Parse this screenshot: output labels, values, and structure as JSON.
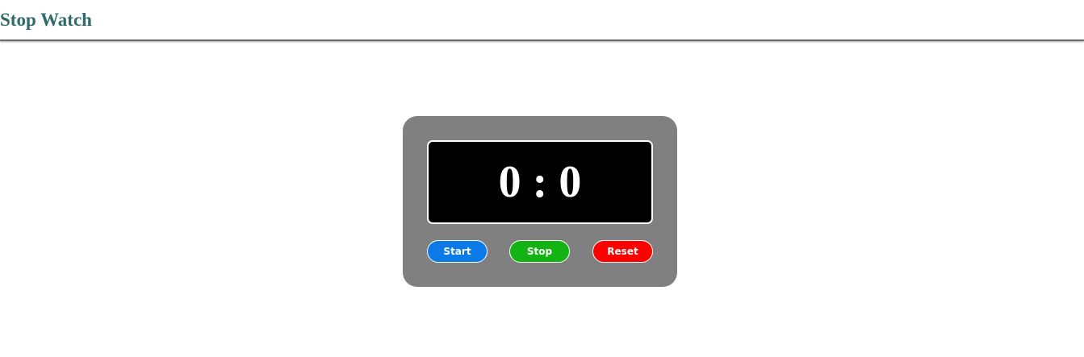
{
  "header": {
    "title": "Stop Watch"
  },
  "stopwatch": {
    "minutes": "0",
    "separator": ":",
    "seconds": "0"
  },
  "buttons": {
    "start_label": "Start",
    "stop_label": "Stop",
    "reset_label": "Reset"
  },
  "colors": {
    "title": "#2f6b6b",
    "panel": "#808080",
    "display": "#000000",
    "start": "#0b7ae8",
    "stop": "#14b314",
    "reset": "#ff0000"
  }
}
